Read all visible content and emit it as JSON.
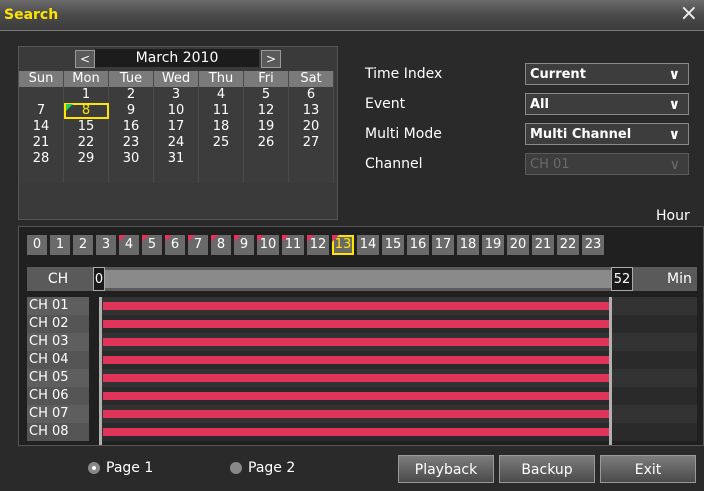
{
  "window": {
    "title": "Search",
    "close_glyph": "×"
  },
  "calendar": {
    "prev": "<",
    "next": ">",
    "month": "March 2010",
    "weekdays": [
      "Sun",
      "Mon",
      "Tue",
      "Wed",
      "Thu",
      "Fri",
      "Sat"
    ],
    "weeks": [
      [
        "",
        "1",
        "2",
        "3",
        "4",
        "5",
        "6"
      ],
      [
        "7",
        "8",
        "9",
        "10",
        "11",
        "12",
        "13"
      ],
      [
        "14",
        "15",
        "16",
        "17",
        "18",
        "19",
        "20"
      ],
      [
        "21",
        "22",
        "23",
        "24",
        "25",
        "26",
        "27"
      ],
      [
        "28",
        "29",
        "30",
        "31",
        "",
        "",
        ""
      ],
      [
        "",
        "",
        "",
        "",
        "",
        "",
        ""
      ]
    ],
    "selected_day": "8"
  },
  "settings": {
    "time_index": {
      "label": "Time Index",
      "value": "Current"
    },
    "event": {
      "label": "Event",
      "value": "All"
    },
    "multi_mode": {
      "label": "Multi Mode",
      "value": "Multi Channel"
    },
    "channel": {
      "label": "Channel",
      "value": "CH 01"
    }
  },
  "hours": {
    "label": "Hour",
    "items": [
      "0",
      "1",
      "2",
      "3",
      "4",
      "5",
      "6",
      "7",
      "8",
      "9",
      "10",
      "11",
      "12",
      "13",
      "14",
      "15",
      "16",
      "17",
      "18",
      "19",
      "20",
      "21",
      "22",
      "23"
    ],
    "marked": [
      "4",
      "5",
      "6",
      "7",
      "8",
      "9",
      "10",
      "11",
      "12",
      "13"
    ],
    "selected": "13"
  },
  "timeline": {
    "ch_header": "CH",
    "start_minute": "0",
    "end_minute": "52",
    "unit": "Min",
    "channels": [
      "CH 01",
      "CH 02",
      "CH 03",
      "CH 04",
      "CH 05",
      "CH 06",
      "CH 07",
      "CH 08"
    ],
    "recorded_fraction": 0.86
  },
  "pages": {
    "page1": "Page 1",
    "page2": "Page 2",
    "selected": "page1"
  },
  "buttons": {
    "playback": "Playback",
    "backup": "Backup",
    "exit": "Exit"
  },
  "colors": {
    "title": "#ffe400",
    "record": "#e0345a",
    "day_marker": "#1fd15a"
  }
}
